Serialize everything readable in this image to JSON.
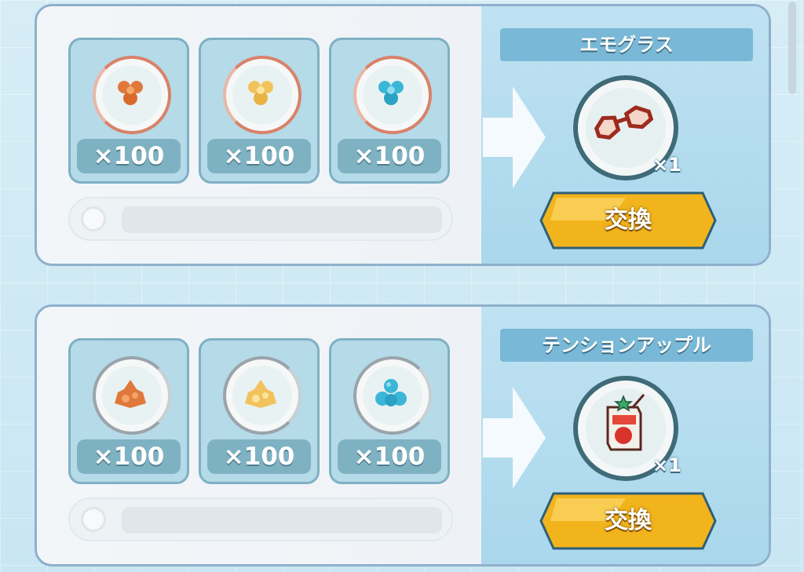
{
  "exchanges": [
    {
      "materials": [
        {
          "icon": "small-orange-crystal-icon",
          "qty": "×100"
        },
        {
          "icon": "small-yellow-crystal-icon",
          "qty": "×100"
        },
        {
          "icon": "small-blue-crystal-icon",
          "qty": "×100"
        }
      ],
      "reward": {
        "name": "エモグラス",
        "icon": "glasses-icon",
        "qty": "×1"
      },
      "button_label": "交換"
    },
    {
      "materials": [
        {
          "icon": "large-orange-crystal-icon",
          "qty": "×100"
        },
        {
          "icon": "large-yellow-crystal-icon",
          "qty": "×100"
        },
        {
          "icon": "large-blue-crystal-icon",
          "qty": "×100"
        }
      ],
      "reward": {
        "name": "テンションアップル",
        "icon": "apple-juice-box-icon",
        "qty": "×1"
      },
      "button_label": "交換"
    }
  ],
  "colors": {
    "orange": "#e0783c",
    "yellow": "#f2c35c",
    "blue": "#3bb6d6",
    "button": "#f2b41c",
    "panel": "#aad7ec"
  }
}
